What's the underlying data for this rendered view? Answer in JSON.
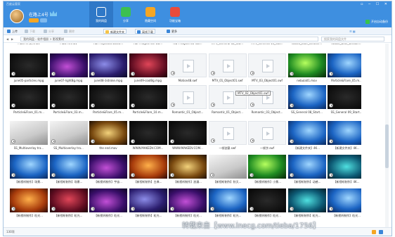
{
  "app": {
    "title": "百度云管家",
    "user_name": "在路上4号"
  },
  "nav": [
    {
      "label": "我的网盘",
      "icon": "cloud-icon",
      "color": "#ffffff",
      "active": true
    },
    {
      "label": "分享",
      "icon": "share-icon",
      "color": "#3cc051",
      "active": false
    },
    {
      "label": "隐藏空间",
      "icon": "lock-icon",
      "color": "#f5a623",
      "active": false
    },
    {
      "label": "功能宝箱",
      "icon": "toolbox-icon",
      "color": "#e94b3c",
      "active": false
    }
  ],
  "autobackup": "开启自动备份",
  "toolbar": {
    "upload": "上传",
    "download": "下载",
    "share": "分享",
    "delete": "删除",
    "new_folder": "新建文件夹",
    "offline": "离线下载",
    "more": "更多"
  },
  "path": {
    "root": "我的网盘",
    "current": "软件相册 > 影视素材"
  },
  "search": {
    "placeholder": "搜索我的网盘文件"
  },
  "files": [
    {
      "name": "Flash 4 (2).mov",
      "type": "video",
      "tone": "dark"
    },
    {
      "name": "Flash 4.mov",
      "type": "video",
      "tone": "dark"
    },
    {
      "name": "HD-Project06-BO01...",
      "type": "video",
      "tone": "dark"
    },
    {
      "name": "HD-PROJECT06-OB...",
      "type": "video",
      "tone": "dark"
    },
    {
      "name": "HD-PROJECT06-OB...",
      "type": "video",
      "tone": "dark"
    },
    {
      "name": "MTV_General 12_Sta...",
      "type": "video",
      "tone": "dark"
    },
    {
      "name": "MTV_General 14_Sta...",
      "type": "video",
      "tone": "dark"
    },
    {
      "name": "iStock_Blue_weddin...",
      "type": "video",
      "tone": "dark"
    },
    {
      "name": "iStock_Blue_weddin...",
      "type": "video",
      "tone": "dark"
    },
    {
      "name": "june05-particles.mpg",
      "type": "video",
      "tone": "dark"
    },
    {
      "name": "june07-lightBg.mpg",
      "type": "video",
      "tone": "purple"
    },
    {
      "name": "june08-3stroke.mpg",
      "type": "video",
      "tone": "violet"
    },
    {
      "name": "june09-coolBg.mpg",
      "type": "video",
      "tone": "crimson"
    },
    {
      "name": "Motion48.swf",
      "type": "doc",
      "tone": "blank"
    },
    {
      "name": "MTV_01_Object01.swf",
      "type": "doc",
      "tone": "blank"
    },
    {
      "name": "MTV_03_Object01.swf",
      "type": "doc",
      "tone": "blank"
    },
    {
      "name": "nebula01.mov",
      "type": "video",
      "tone": "green"
    },
    {
      "name": "Particle&Flare_05.m...",
      "type": "video",
      "tone": "blue"
    },
    {
      "name": "Particle&Flare_01.m...",
      "type": "video",
      "tone": "dark"
    },
    {
      "name": "Particle&Flare_03.m...",
      "type": "video",
      "tone": "dark"
    },
    {
      "name": "Particle&Flare_05.m...",
      "type": "video",
      "tone": "dark"
    },
    {
      "name": "Particle&Flare_10.m...",
      "type": "video",
      "tone": "dark"
    },
    {
      "name": "Romantic_01_Object...",
      "type": "doc",
      "tone": "blank"
    },
    {
      "name": "Romantic_01_Object...",
      "type": "doc",
      "tone": "blank"
    },
    {
      "name": "Romantic_03_Object...",
      "type": "doc",
      "tone": "blank"
    },
    {
      "name": "SS_General 08_Start...",
      "type": "video",
      "tone": "blue"
    },
    {
      "name": "SS_General 09_Start...",
      "type": "video",
      "tone": "dark"
    },
    {
      "name": "SS_Multioverlay tra...",
      "type": "video",
      "tone": "white"
    },
    {
      "name": "SS_Multioverlay tra...",
      "type": "video",
      "tone": "white"
    },
    {
      "name": "the end.mov",
      "type": "video",
      "tone": "gold"
    },
    {
      "name": "WWW.MAKEDV.COM...",
      "type": "video",
      "tone": "dark"
    },
    {
      "name": "WWW.MAKEDV.COM...",
      "type": "video",
      "tone": "dark"
    },
    {
      "name": "一帧创意.swf",
      "type": "doc",
      "tone": "blank"
    },
    {
      "name": "一帧字.swf",
      "type": "doc",
      "tone": "blank"
    },
    {
      "name": "【新建文件夹】4K...",
      "type": "video",
      "tone": "blue"
    },
    {
      "name": "【新建文件夹】4K...",
      "type": "video",
      "tone": "blue"
    },
    {
      "name": "【新视听制作】场景...",
      "type": "video",
      "tone": "blue"
    },
    {
      "name": "【新视听制作】场景...",
      "type": "video",
      "tone": "blue"
    },
    {
      "name": "【新视听制作】宇宙...",
      "type": "video",
      "tone": "purple"
    },
    {
      "name": "【新视听制作】古典...",
      "type": "video",
      "tone": "orange"
    },
    {
      "name": "【新视听制作】浪漫...",
      "type": "video",
      "tone": "gold"
    },
    {
      "name": "【新视听制作】秋天...",
      "type": "video",
      "tone": "white"
    },
    {
      "name": "【新视听制作】小景...",
      "type": "video",
      "tone": "green"
    },
    {
      "name": "【新视听制作】动感...",
      "type": "video",
      "tone": "blue"
    },
    {
      "name": "【新视听制作】4K...",
      "type": "video",
      "tone": "teal"
    },
    {
      "name": "【新视听制作】粒光...",
      "type": "video",
      "tone": "orange"
    },
    {
      "name": "【新视听制作】粒光...",
      "type": "video",
      "tone": "crimson"
    },
    {
      "name": "【新视听制作】粒光...",
      "type": "video",
      "tone": "purple"
    },
    {
      "name": "【新视听制作】粒光...",
      "type": "video",
      "tone": "violet"
    },
    {
      "name": "【新视听制作】粒光...",
      "type": "video",
      "tone": "purple"
    },
    {
      "name": "【新视听制作】粒光...",
      "type": "video",
      "tone": "blue"
    },
    {
      "name": "【新视听制作】粒光...",
      "type": "video",
      "tone": "dark"
    },
    {
      "name": "【新视听制作】粒光...",
      "type": "video",
      "tone": "teal"
    },
    {
      "name": "【新视听制作】粒光...",
      "type": "video",
      "tone": "blue"
    }
  ],
  "tooltip": "MTV_02_Object01.swf",
  "status": {
    "count": "130项"
  },
  "watermark": "转载来自【www.lnecg.com/tieba/1756】",
  "colors": {
    "header": "#3e8fe0",
    "active_nav": "#2f78c7"
  }
}
